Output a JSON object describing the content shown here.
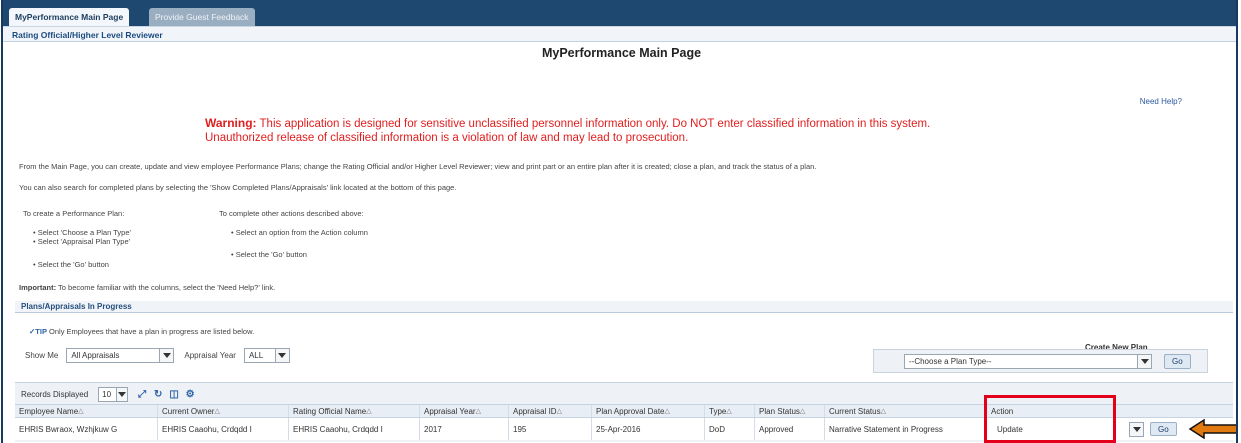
{
  "tabs": [
    {
      "label": "MyPerformance Main Page",
      "active": true
    },
    {
      "label": "Provide Guest Feedback",
      "active": false
    }
  ],
  "subheader": "Rating Official/Higher Level Reviewer",
  "page_title": "MyPerformance Main Page",
  "need_help": "Need Help?",
  "warning": {
    "prefix": "Warning:",
    "line1": " This application is designed for sensitive unclassified personnel information only. Do NOT enter classified information in this system.",
    "line2": "Unauthorized release of classified information is a violation of law and may lead to prosecution."
  },
  "intro": {
    "p1": "From the Main Page, you can create, update and view employee Performance Plans; change the Rating Official and/or Higher Level Reviewer; view and print part or an entire plan after it is created; close a plan, and track the status of a plan.",
    "p2": "You can also search for completed plans by selecting the 'Show Completed Plans/Appraisals' link located at the bottom of this page.",
    "create_heading": "To create a Performance Plan:",
    "create_steps": [
      "Select 'Choose a Plan Type'",
      "Select 'Appraisal Plan Type'",
      "Select the 'Go' button"
    ],
    "other_heading": "To complete other actions described above:",
    "other_steps": [
      "Select an option from the Action column",
      "Select the 'Go' button"
    ],
    "important_label": "Important:",
    "important_text": " To become familiar with the columns, select the 'Need Help?' link."
  },
  "section_title": "Plans/Appraisals In Progress",
  "tip": {
    "label": "TIP",
    "text": " Only Employees that have a plan in progress are listed below."
  },
  "filters": {
    "show_me_label": "Show Me",
    "show_me_value": "All Appraisals",
    "year_label": "Appraisal Year",
    "year_value": "ALL"
  },
  "create_plan": {
    "label": "Create New Plan",
    "select_value": "--Choose a Plan Type--",
    "go_label": "Go"
  },
  "table": {
    "records_label": "Records Displayed",
    "records_value": "10",
    "headers": [
      "Employee Name",
      "Current Owner",
      "Rating Official Name",
      "Appraisal Year",
      "Appraisal ID",
      "Plan Approval Date",
      "Type",
      "Plan Status",
      "Current Status",
      "Action"
    ],
    "rows": [
      {
        "cells": [
          "EHRIS Bwraox, Wzhjkuw G",
          "EHRIS Caaohu, Crdqdd I",
          "EHRIS Caaohu, Crdqdd I",
          "2017",
          "195",
          "25-Apr-2016",
          "DoD",
          "Approved",
          "Narrative Statement in Progress",
          "Update"
        ],
        "go_label": "Go"
      }
    ]
  },
  "colors": {
    "header_bar": "#1e4870",
    "warning": "#e01e1e",
    "highlight": "#e3001b",
    "arrow": "#e07a10"
  },
  "icons": [
    "tip-check-icon",
    "dropdown-arrow-icon",
    "column-settings-icon",
    "refresh-icon",
    "export-icon",
    "gear-icon",
    "pointer-arrow-icon"
  ]
}
